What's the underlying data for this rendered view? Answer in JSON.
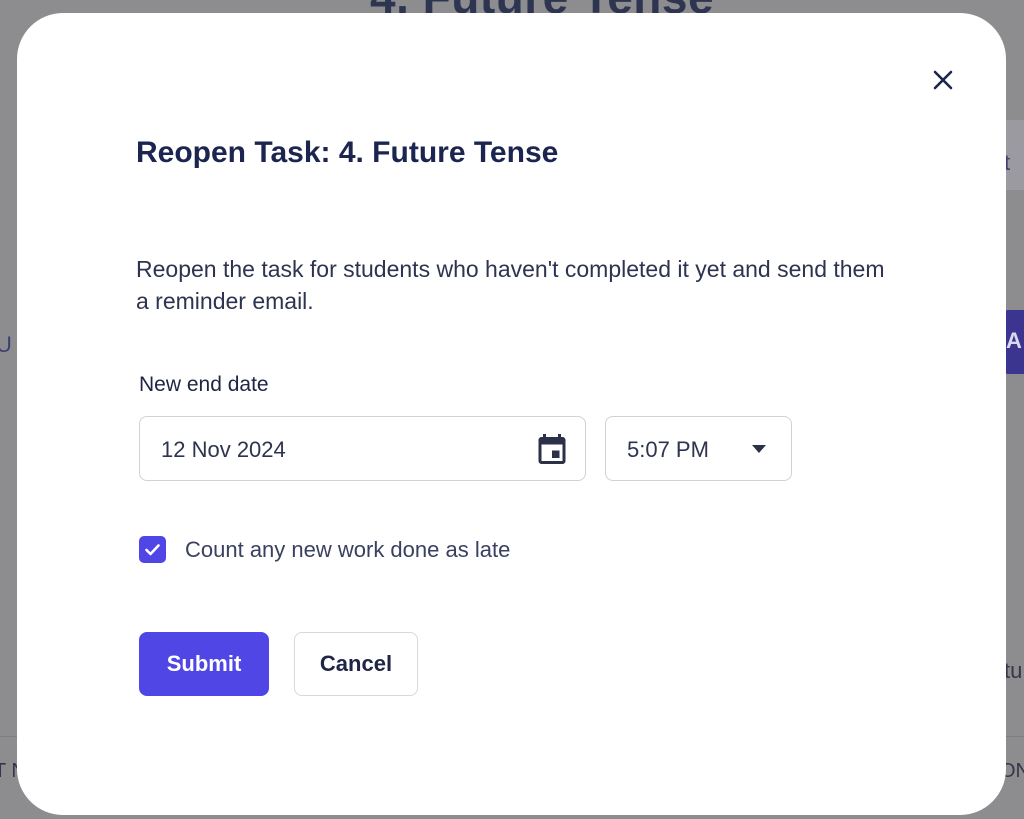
{
  "background": {
    "page_title": "4. Future Tense",
    "right_text_fragment": "t",
    "left_text_fragment": "U",
    "right_button_fragment": "A",
    "right_text_fragment_2": "tu",
    "left_bottom_fragment": "T N",
    "right_bottom_fragment": "ON"
  },
  "modal": {
    "title": "Reopen Task: 4. Future Tense",
    "description": "Reopen the task for students who haven't completed it yet and send them a reminder email.",
    "close_icon": "close-icon",
    "end_date": {
      "label": "New end date",
      "date_value": "12 Nov 2024",
      "date_icon": "calendar-icon",
      "time_value": "5:07 PM",
      "time_icon": "caret-down-icon"
    },
    "late_checkbox": {
      "checked": true,
      "label": "Count any new work done as late"
    },
    "actions": {
      "submit_label": "Submit",
      "cancel_label": "Cancel"
    }
  },
  "colors": {
    "primary": "#4f46e5",
    "heading": "#1b2550",
    "text": "#2e3450",
    "border": "#cfd2da",
    "overlay": "#8d8d90"
  }
}
